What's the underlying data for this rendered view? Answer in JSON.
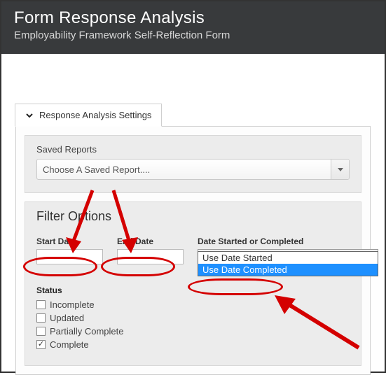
{
  "header": {
    "title": "Form Response Analysis",
    "subtitle": "Employability Framework Self-Reflection Form"
  },
  "tab": {
    "label": "Response Analysis Settings"
  },
  "saved_reports": {
    "label": "Saved Reports",
    "placeholder": "Choose A Saved Report...."
  },
  "filter": {
    "title": "Filter Options",
    "start_date_label": "Start Date",
    "end_date_label": "End Date",
    "date_mode_label": "Date Started or Completed",
    "date_mode_selected": "Use Date Started",
    "date_mode_options": [
      "Use Date Started",
      "Use Date Completed"
    ]
  },
  "status": {
    "title": "Status",
    "options": [
      {
        "label": "Incomplete",
        "checked": false
      },
      {
        "label": "Updated",
        "checked": false
      },
      {
        "label": "Partially Complete",
        "checked": false
      },
      {
        "label": "Complete",
        "checked": true
      }
    ]
  }
}
